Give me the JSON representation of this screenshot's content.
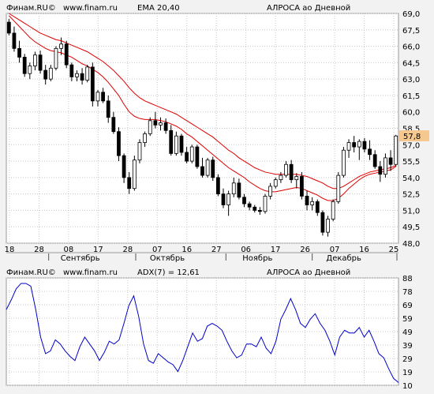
{
  "top_panel": {
    "source_label": "Финам.RU©",
    "site_label": "www.finam.ru",
    "indicator_label": "EMA 20,40",
    "instrument_label": "АЛРОСА ао Дневной",
    "last_price_label": "57,8"
  },
  "bottom_panel": {
    "source_label": "Финам.RU©",
    "site_label": "www.finam.ru",
    "indicator_label": "ADX(7) = 12,61",
    "instrument_label": "АЛРОСА ао Дневной"
  },
  "colors": {
    "up_candle": "#ffffff",
    "down_candle": "#000000",
    "ema": "#e00000",
    "adx": "#0000cc",
    "grid": "#c8c8c8",
    "plot_bg": "#ffffff",
    "indicator_text": "#e00000",
    "adx_text": "#0000cc",
    "last_price_bg": "#f5c890"
  },
  "chart_data": [
    {
      "type": "candlestick",
      "title": "АЛРОСА ао Дневной",
      "indicator": "EMA 20,40",
      "ylim": [
        48.0,
        69.0
      ],
      "y_ticks": [
        "69,0",
        "67,5",
        "66,0",
        "64,5",
        "63,0",
        "61,5",
        "60,0",
        "58,5",
        "57,0",
        "55,5",
        "54,0",
        "52,5",
        "51,0",
        "49,5",
        "48,0"
      ],
      "x_ticks": [
        "18",
        "28",
        "08",
        "17",
        "28",
        "07",
        "16",
        "27",
        "06",
        "17",
        "26",
        "07",
        "16",
        "25"
      ],
      "month_labels": [
        "Сентябрь",
        "Октябрь",
        "Ноябрь",
        "Декабрь"
      ],
      "last_price": 57.8,
      "candles": [
        [
          68.2,
          68.5,
          67.0,
          67.2
        ],
        [
          67.2,
          67.8,
          65.5,
          65.8
        ],
        [
          65.8,
          66.5,
          64.5,
          65.0
        ],
        [
          65.0,
          65.3,
          63.2,
          63.5
        ],
        [
          63.5,
          64.5,
          63.0,
          64.2
        ],
        [
          64.2,
          65.5,
          63.8,
          65.2
        ],
        [
          65.2,
          65.6,
          63.5,
          63.8
        ],
        [
          63.8,
          64.3,
          62.5,
          63.0
        ],
        [
          63.0,
          64.3,
          62.8,
          64.0
        ],
        [
          64.0,
          66.0,
          63.8,
          65.8
        ],
        [
          65.8,
          66.8,
          65.2,
          66.2
        ],
        [
          66.2,
          66.5,
          64.0,
          64.3
        ],
        [
          64.3,
          64.5,
          62.8,
          63.2
        ],
        [
          63.2,
          63.8,
          62.8,
          63.5
        ],
        [
          63.5,
          64.0,
          62.5,
          62.9
        ],
        [
          62.9,
          64.3,
          62.7,
          64.1
        ],
        [
          64.1,
          64.5,
          60.5,
          61.0
        ],
        [
          61.0,
          62.0,
          60.5,
          61.8
        ],
        [
          61.8,
          62.2,
          60.8,
          61.0
        ],
        [
          61.0,
          61.5,
          59.0,
          59.5
        ],
        [
          59.5,
          60.0,
          58.0,
          58.2
        ],
        [
          58.2,
          58.6,
          55.5,
          56.0
        ],
        [
          56.0,
          56.2,
          53.5,
          54.0
        ],
        [
          54.0,
          54.5,
          52.5,
          53.0
        ],
        [
          53.0,
          56.0,
          52.8,
          55.6
        ],
        [
          55.6,
          57.5,
          55.3,
          57.2
        ],
        [
          57.2,
          58.2,
          56.8,
          58.0
        ],
        [
          58.0,
          59.5,
          57.8,
          59.2
        ],
        [
          59.2,
          60.0,
          58.5,
          58.8
        ],
        [
          58.8,
          59.5,
          58.3,
          59.0
        ],
        [
          59.0,
          59.4,
          58.0,
          58.3
        ],
        [
          58.3,
          58.8,
          56.0,
          56.2
        ],
        [
          56.2,
          58.2,
          56.0,
          57.8
        ],
        [
          57.8,
          58.0,
          56.0,
          56.3
        ],
        [
          56.3,
          56.8,
          55.3,
          55.5
        ],
        [
          55.5,
          57.0,
          55.3,
          56.8
        ],
        [
          56.8,
          57.0,
          54.8,
          55.0
        ],
        [
          55.0,
          55.8,
          54.0,
          54.2
        ],
        [
          54.2,
          55.8,
          54.0,
          55.6
        ],
        [
          55.6,
          55.9,
          53.7,
          54.0
        ],
        [
          54.0,
          54.3,
          52.3,
          52.5
        ],
        [
          52.5,
          53.0,
          51.2,
          51.5
        ],
        [
          51.5,
          52.8,
          50.5,
          52.5
        ],
        [
          52.5,
          54.0,
          52.2,
          53.5
        ],
        [
          53.5,
          53.9,
          52.0,
          52.2
        ],
        [
          52.2,
          52.5,
          51.3,
          51.6
        ],
        [
          51.6,
          51.8,
          51.0,
          51.3
        ],
        [
          51.3,
          51.5,
          50.8,
          51.0
        ],
        [
          51.0,
          51.3,
          50.6,
          50.9
        ],
        [
          50.9,
          52.5,
          50.7,
          52.3
        ],
        [
          52.3,
          53.5,
          52.0,
          53.2
        ],
        [
          53.2,
          54.0,
          53.0,
          53.8
        ],
        [
          53.8,
          54.5,
          53.5,
          54.2
        ],
        [
          54.2,
          55.5,
          54.0,
          55.2
        ],
        [
          55.2,
          55.6,
          53.5,
          53.8
        ],
        [
          53.8,
          54.4,
          53.0,
          54.1
        ],
        [
          54.1,
          54.5,
          52.0,
          52.3
        ],
        [
          52.3,
          52.8,
          51.0,
          51.5
        ],
        [
          51.5,
          52.2,
          51.0,
          51.8
        ],
        [
          51.8,
          52.0,
          50.5,
          50.8
        ],
        [
          50.8,
          51.0,
          48.7,
          49.0
        ],
        [
          49.0,
          50.5,
          48.6,
          50.2
        ],
        [
          50.2,
          52.0,
          50.0,
          51.8
        ],
        [
          51.8,
          54.5,
          51.6,
          54.2
        ],
        [
          54.2,
          56.8,
          54.0,
          56.5
        ],
        [
          56.5,
          57.5,
          55.8,
          57.2
        ],
        [
          57.2,
          57.8,
          56.3,
          56.8
        ],
        [
          56.8,
          57.5,
          55.6,
          57.3
        ],
        [
          57.3,
          57.6,
          56.3,
          56.6
        ],
        [
          56.6,
          57.4,
          55.6,
          56.1
        ],
        [
          56.1,
          56.5,
          54.8,
          55.0
        ],
        [
          55.0,
          55.5,
          53.6,
          54.3
        ],
        [
          54.3,
          56.2,
          54.0,
          55.8
        ],
        [
          55.8,
          56.5,
          54.6,
          55.2
        ],
        [
          55.2,
          57.9,
          55.0,
          57.8
        ]
      ],
      "series": [
        {
          "values": [
            68.8,
            68.3,
            67.8,
            67.3,
            66.8,
            66.4,
            66.1,
            65.8,
            65.6,
            65.5,
            65.4,
            65.2,
            65.0,
            64.7,
            64.4,
            64.2,
            63.9,
            63.6,
            63.2,
            62.7,
            62.1,
            61.5,
            60.7,
            60.0,
            59.6,
            59.4,
            59.3,
            59.3,
            59.3,
            59.2,
            59.1,
            58.9,
            58.7,
            58.4,
            58.0,
            57.7,
            57.3,
            56.9,
            56.5,
            56.1,
            55.7,
            55.3,
            54.9,
            54.6,
            54.3,
            54.0,
            53.6,
            53.3,
            53.0,
            52.8,
            52.7,
            52.7,
            52.8,
            52.9,
            53.0,
            53.1,
            53.0,
            52.8,
            52.6,
            52.4,
            52.1,
            51.9,
            51.9,
            52.1,
            52.5,
            53.0,
            53.4,
            53.8,
            54.1,
            54.3,
            54.4,
            54.5,
            54.6,
            54.7,
            55.0
          ]
        },
        {
          "values": [
            69.0,
            68.7,
            68.4,
            68.1,
            67.8,
            67.5,
            67.2,
            67.0,
            66.8,
            66.6,
            66.5,
            66.3,
            66.1,
            65.9,
            65.7,
            65.5,
            65.2,
            64.9,
            64.6,
            64.2,
            63.8,
            63.3,
            62.8,
            62.2,
            61.7,
            61.3,
            61.0,
            60.8,
            60.6,
            60.4,
            60.2,
            60.0,
            59.8,
            59.5,
            59.2,
            58.9,
            58.6,
            58.3,
            58.0,
            57.7,
            57.3,
            56.9,
            56.5,
            56.2,
            55.8,
            55.5,
            55.2,
            54.9,
            54.7,
            54.5,
            54.4,
            54.3,
            54.3,
            54.3,
            54.3,
            54.3,
            54.2,
            54.1,
            53.9,
            53.7,
            53.5,
            53.2,
            53.0,
            53.0,
            53.2,
            53.5,
            53.8,
            54.1,
            54.3,
            54.5,
            54.6,
            54.7,
            54.8,
            54.9,
            55.1
          ]
        }
      ]
    },
    {
      "type": "line",
      "title": "АЛРОСА ао Дневной",
      "indicator": "ADX(7) = 12,61",
      "ylim": [
        10,
        88
      ],
      "y_ticks": [
        "88",
        "78",
        "69",
        "59",
        "49",
        "39",
        "29",
        "19",
        "10"
      ],
      "series": [
        {
          "values": [
            65,
            72,
            80,
            84,
            84,
            82,
            65,
            45,
            33,
            35,
            43,
            40,
            35,
            31,
            28,
            38,
            45,
            40,
            35,
            28,
            34,
            42,
            40,
            43,
            55,
            68,
            75,
            60,
            40,
            28,
            26,
            33,
            30,
            27,
            25,
            20,
            28,
            38,
            48,
            42,
            44,
            53,
            55,
            53,
            50,
            42,
            35,
            30,
            32,
            40,
            40,
            38,
            45,
            37,
            33,
            42,
            58,
            65,
            73,
            65,
            55,
            52,
            58,
            62,
            55,
            50,
            42,
            32,
            45,
            50,
            48,
            48,
            52,
            45,
            50,
            42,
            33,
            30,
            22,
            15,
            12
          ]
        }
      ]
    }
  ]
}
